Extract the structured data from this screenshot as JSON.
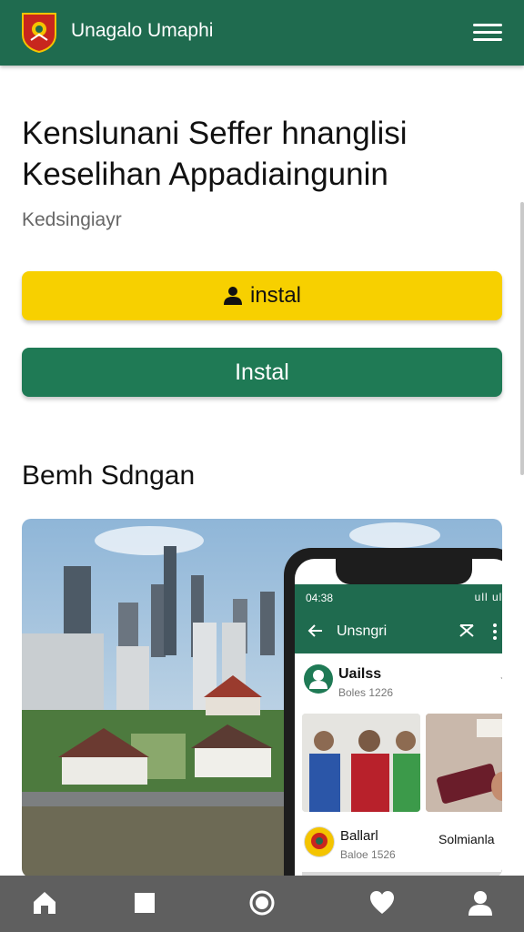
{
  "header": {
    "app_title": "Unagalo Umaphi",
    "logo_icon": "crest-logo-icon",
    "menu_icon": "hamburger-menu-icon"
  },
  "main": {
    "headline_line1": "Kenslunani Seffer hnanglisi",
    "headline_line2": "Keselihan Appadiaingunin",
    "subtitle": "Kedsingiayr",
    "buttons": {
      "primary_label": "instal",
      "primary_icon": "user-icon",
      "secondary_label": "Instal"
    },
    "section_title": "Bemh Sdngan"
  },
  "phone_mockup": {
    "status_time": "04:38",
    "status_signal": "ull ull",
    "appbar_title": "Unsngri",
    "post1": {
      "name": "Uailss",
      "date": "Boles 1226"
    },
    "post2": {
      "name": "Ballarl",
      "date": "Baloe 1526",
      "other_name": "Solmianla"
    }
  },
  "bottom_nav": {
    "items": [
      {
        "icon": "home-icon"
      },
      {
        "icon": "square-icon"
      },
      {
        "icon": "record-icon"
      },
      {
        "icon": "heart-icon"
      },
      {
        "icon": "person-icon"
      }
    ]
  },
  "colors": {
    "header_green": "#1f6b4f",
    "button_yellow": "#f7d000",
    "button_green": "#1f7a55",
    "nav_gray": "#5f5f5f"
  }
}
